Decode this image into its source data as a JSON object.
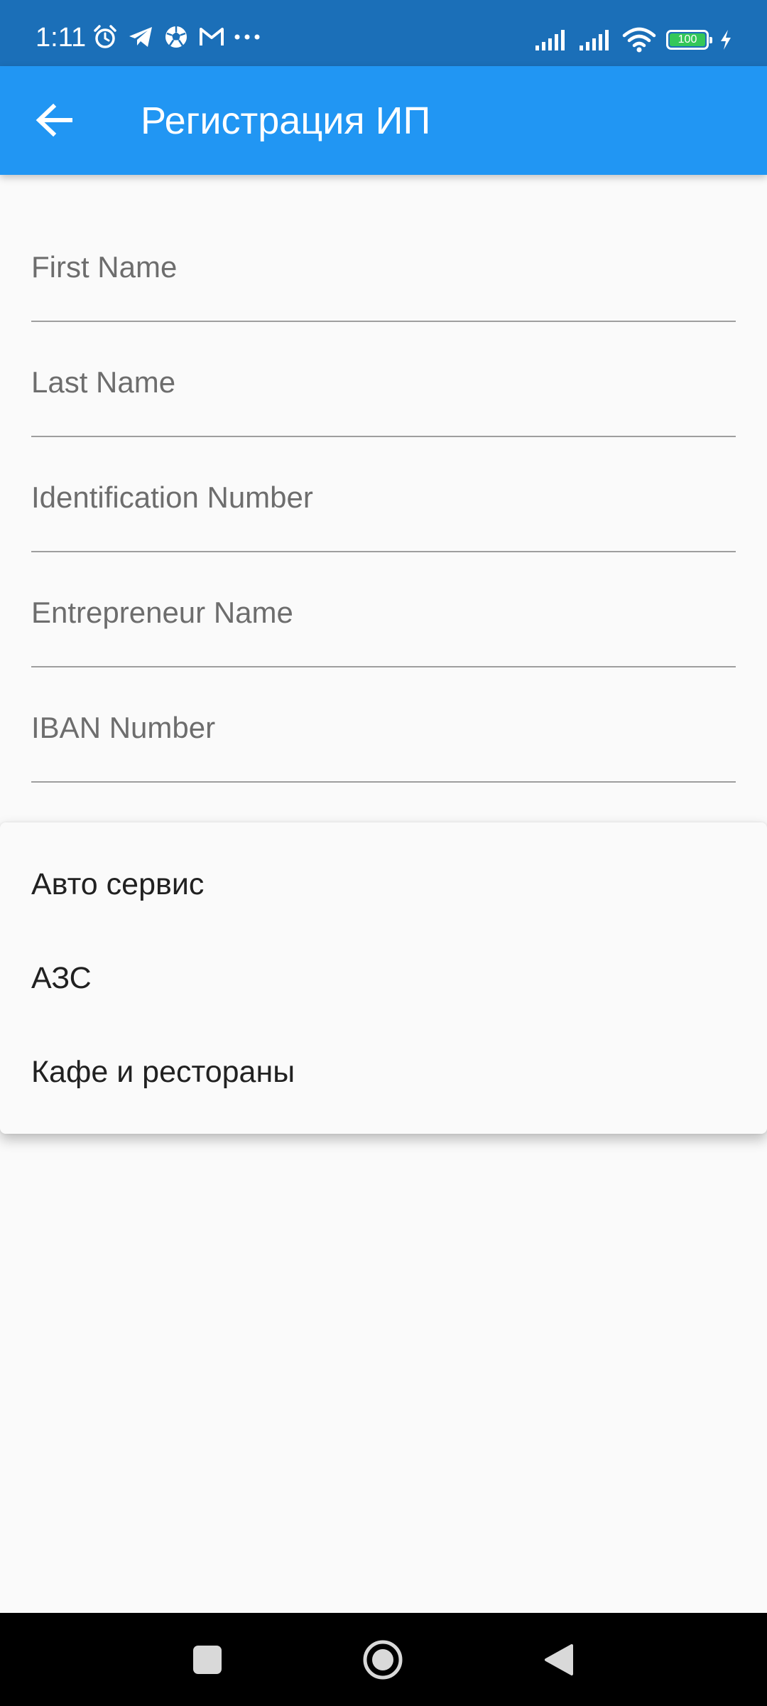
{
  "status_bar": {
    "time": "1:11",
    "left_icons": [
      "alarm-icon",
      "telegram-icon",
      "soccer-ball-icon",
      "gmail-icon",
      "more-dots-icon"
    ],
    "right_icons": [
      "signal-icon",
      "signal-icon",
      "wifi-icon",
      "battery-icon",
      "charging-icon"
    ],
    "battery_level": "100",
    "battery_color": "#34c759",
    "background": "#1b6fb8"
  },
  "app_bar": {
    "title": "Регистрация ИП",
    "back_icon": "arrow-back-icon",
    "background": "#2196f3"
  },
  "form": {
    "fields": [
      {
        "label": "First Name",
        "value": ""
      },
      {
        "label": "Last Name",
        "value": ""
      },
      {
        "label": "Identification Number",
        "value": ""
      },
      {
        "label": "Entrepreneur Name",
        "value": ""
      },
      {
        "label": "IBAN Number",
        "value": ""
      }
    ]
  },
  "dropdown_menu": {
    "items": [
      {
        "label": "Авто сервис"
      },
      {
        "label": "АЗС"
      },
      {
        "label": "Кафе и рестораны"
      }
    ]
  },
  "nav_bar": {
    "buttons": [
      "recents-square-icon",
      "home-circle-icon",
      "back-triangle-icon"
    ]
  }
}
